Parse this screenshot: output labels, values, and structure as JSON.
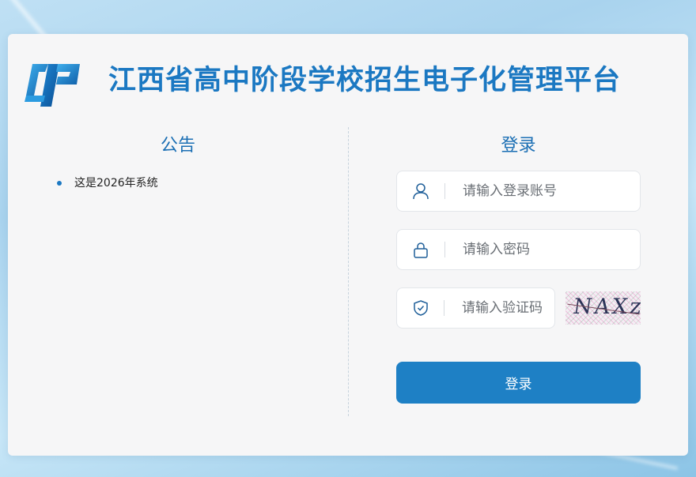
{
  "header": {
    "title": "江西省高中阶段学校招生电子化管理平台",
    "logo_icon": "zhongkao-logo-icon"
  },
  "notice": {
    "title": "公告",
    "items": [
      "这是2026年系统"
    ]
  },
  "login": {
    "title": "登录",
    "username": {
      "placeholder": "请输入登录账号",
      "value": "",
      "icon": "user-icon"
    },
    "password": {
      "placeholder": "请输入密码",
      "value": "",
      "icon": "lock-icon"
    },
    "captcha": {
      "placeholder": "请输入验证码",
      "value": "",
      "icon": "shield-check-icon",
      "image_text": "NAXz"
    },
    "submit_label": "登录"
  },
  "colors": {
    "brand": "#1b78c2",
    "button": "#1e80c5",
    "card_bg": "#f6f6f7"
  }
}
